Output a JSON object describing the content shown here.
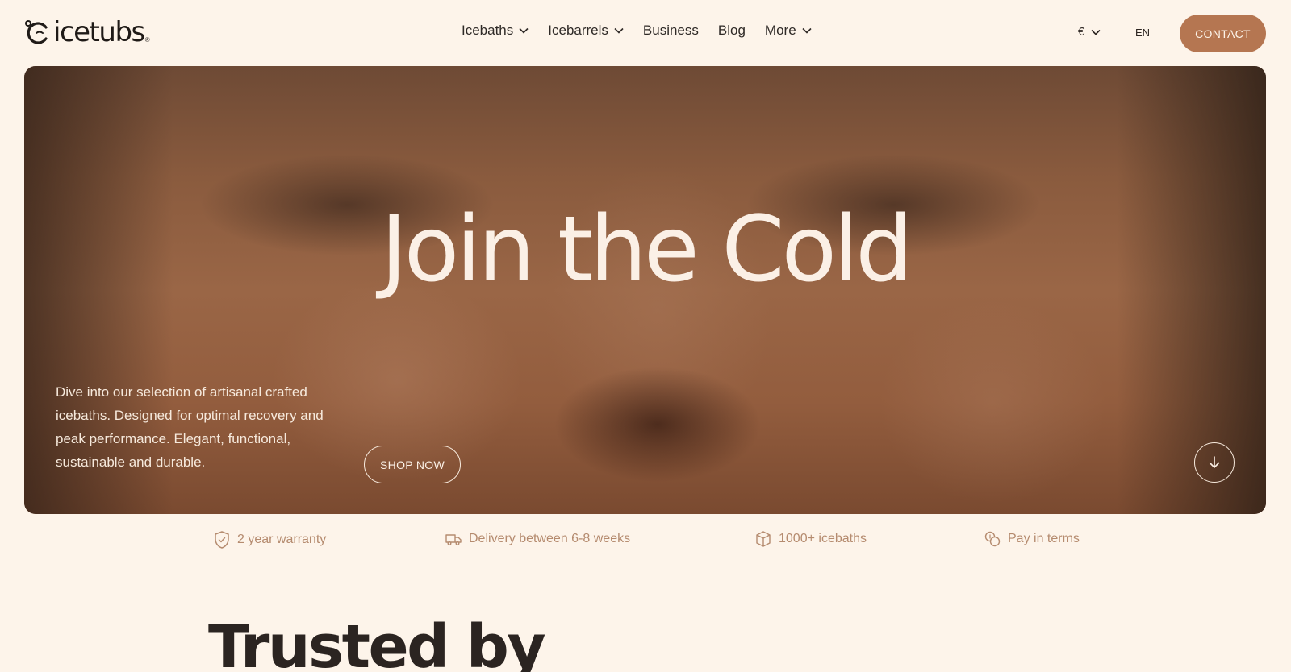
{
  "header": {
    "logo_text": "icetubs",
    "logo_reg": "®",
    "nav": [
      {
        "label": "Icebaths",
        "has_dropdown": true
      },
      {
        "label": "Icebarrels",
        "has_dropdown": true
      },
      {
        "label": "Business",
        "has_dropdown": false
      },
      {
        "label": "Blog",
        "has_dropdown": false
      },
      {
        "label": "More",
        "has_dropdown": true
      }
    ],
    "currency": "€",
    "language": "EN",
    "contact_label": "CONTACT"
  },
  "hero": {
    "title": "Join the Cold",
    "description": "Dive into our selection of artisanal crafted icebaths. Designed for optimal recovery and peak performance. Elegant, functional, sustainable and durable.",
    "cta_label": "SHOP NOW",
    "scroll_icon": "arrow-down-icon"
  },
  "features": [
    {
      "label": "2 year warranty",
      "icon": "shield-check-icon"
    },
    {
      "label": "Delivery between 6-8 weeks",
      "icon": "truck-icon"
    },
    {
      "label": "1000+ icebaths",
      "icon": "box-icon"
    },
    {
      "label": "Pay in terms",
      "icon": "coins-icon"
    }
  ],
  "section": {
    "heading": "Trusted by"
  },
  "colors": {
    "background": "#fdf4ea",
    "accent": "#b57651",
    "feature_text": "#b58b6f",
    "dark_text": "#2b2421"
  }
}
